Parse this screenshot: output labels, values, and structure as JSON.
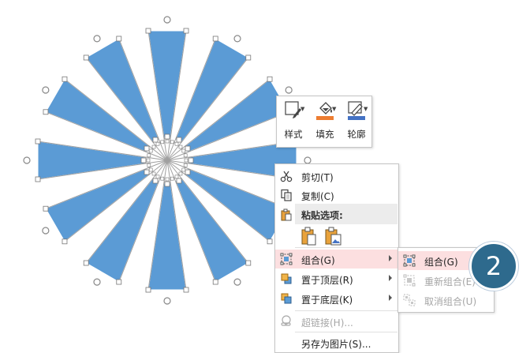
{
  "colors": {
    "shape_fill": "#5b9bd5",
    "shape_outline": "#ffffff",
    "selection_line": "#a0a0a0",
    "menu_highlight": "#fcdfe0",
    "badge": "#2e6a8d",
    "fill_accent": "#ed7d31",
    "outline_accent": "#4472c4"
  },
  "mini_toolbar": {
    "style_label": "样式",
    "fill_label": "填充",
    "outline_label": "轮廓",
    "style_icon": "shape-style-icon",
    "fill_icon": "paint-bucket-icon",
    "outline_icon": "pen-outline-icon"
  },
  "context_menu": {
    "cut": "剪切(T)",
    "copy": "复制(C)",
    "paste_options": "粘贴选项:",
    "group": "组合(G)",
    "bring_to_front": "置于顶层(R)",
    "send_to_back": "置于底层(K)",
    "hyperlink": "超链接(H)...",
    "save_as_picture": "另存为图片(S)..."
  },
  "submenu": {
    "group": "组合(G)",
    "regroup": "重新组合(E)",
    "ungroup": "取消组合(U)"
  },
  "step_badge": "2"
}
